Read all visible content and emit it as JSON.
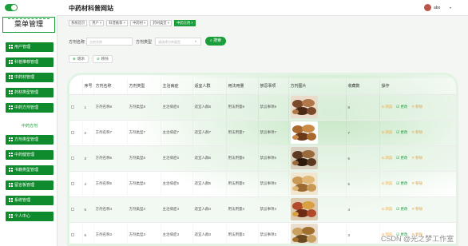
{
  "header": {
    "title": "中药材科普网站",
    "username": "abo"
  },
  "sidebar": {
    "menu_title": "菜单管理",
    "items": [
      {
        "label": "用户管理",
        "type": "item"
      },
      {
        "label": "科普推荐管理",
        "type": "item"
      },
      {
        "label": "中药材管理",
        "type": "item"
      },
      {
        "label": "药材类型管理",
        "type": "item"
      },
      {
        "label": "中药方剂管理",
        "type": "item"
      },
      {
        "label": "中药方剂",
        "type": "sub"
      },
      {
        "label": "方剂类型管理",
        "type": "item"
      },
      {
        "label": "中药健管理",
        "type": "item"
      },
      {
        "label": "书籍类型管理",
        "type": "item"
      },
      {
        "label": "留言板管理",
        "type": "item"
      },
      {
        "label": "系统管理",
        "type": "item"
      },
      {
        "label": "个人中心",
        "type": "item"
      }
    ]
  },
  "tags": [
    {
      "label": "系统首页",
      "closable": false,
      "active": false
    },
    {
      "label": "用户",
      "closable": true,
      "active": false
    },
    {
      "label": "科普推荐",
      "closable": true,
      "active": false
    },
    {
      "label": "中药材",
      "closable": true,
      "active": false
    },
    {
      "label": "药材类型",
      "closable": true,
      "active": false
    },
    {
      "label": "中药方剂",
      "closable": true,
      "active": true
    }
  ],
  "search": {
    "name_label": "方剂名称",
    "name_placeholder": "方剂名称",
    "type_label": "方剂类型",
    "type_placeholder": "请选择方剂类型",
    "button": "搜索"
  },
  "actions": {
    "add": "增添",
    "delete": "移除"
  },
  "table": {
    "columns": [
      "序号",
      "方剂名称",
      "方剂类型",
      "主治病症",
      "适宜人群",
      "用法用量",
      "禁忌事项",
      "方剂图片",
      "收藏数",
      "操作"
    ],
    "rows": [
      {
        "no": "1",
        "name": "方剂名称8",
        "type": "方剂类型8",
        "disease": "主治病症8",
        "people": "适宜人群8",
        "usage": "用法用量8",
        "taboo": "禁忌事项8",
        "img": "herb-1",
        "fav": "8"
      },
      {
        "no": "2",
        "name": "方剂名称7",
        "type": "方剂类型7",
        "disease": "主治病症7",
        "people": "适宜人群7",
        "usage": "用法用量7",
        "taboo": "禁忌事项7",
        "img": "herb-2",
        "fav": "7"
      },
      {
        "no": "3",
        "name": "方剂名称6",
        "type": "方剂类型6",
        "disease": "主治病症6",
        "people": "适宜人群6",
        "usage": "用法用量6",
        "taboo": "禁忌事项6",
        "img": "herb-3",
        "fav": "6"
      },
      {
        "no": "4",
        "name": "方剂名称5",
        "type": "方剂类型5",
        "disease": "主治病症5",
        "people": "适宜人群5",
        "usage": "用法用量5",
        "taboo": "禁忌事项5",
        "img": "herb-4",
        "fav": "5"
      },
      {
        "no": "5",
        "name": "方剂名称4",
        "type": "方剂类型4",
        "disease": "主治病症4",
        "people": "适宜人群4",
        "usage": "用法用量4",
        "taboo": "禁忌事项4",
        "img": "herb-5",
        "fav": "4"
      },
      {
        "no": "6",
        "name": "方剂名称3",
        "type": "方剂类型3",
        "disease": "主治病症3",
        "people": "适宜人群3",
        "usage": "用法用量3",
        "taboo": "禁忌事项3",
        "img": "herb-6",
        "fav": "3"
      }
    ],
    "row_actions": {
      "view": "浏览",
      "edit": "更改",
      "delete": "移除"
    }
  },
  "watermark": "CSDN @光之梦工作室",
  "colors": {
    "accent": "#1a9e3a",
    "menu": "#0f8a2c",
    "view": "#e6a23c",
    "delete": "#e05a4e"
  }
}
